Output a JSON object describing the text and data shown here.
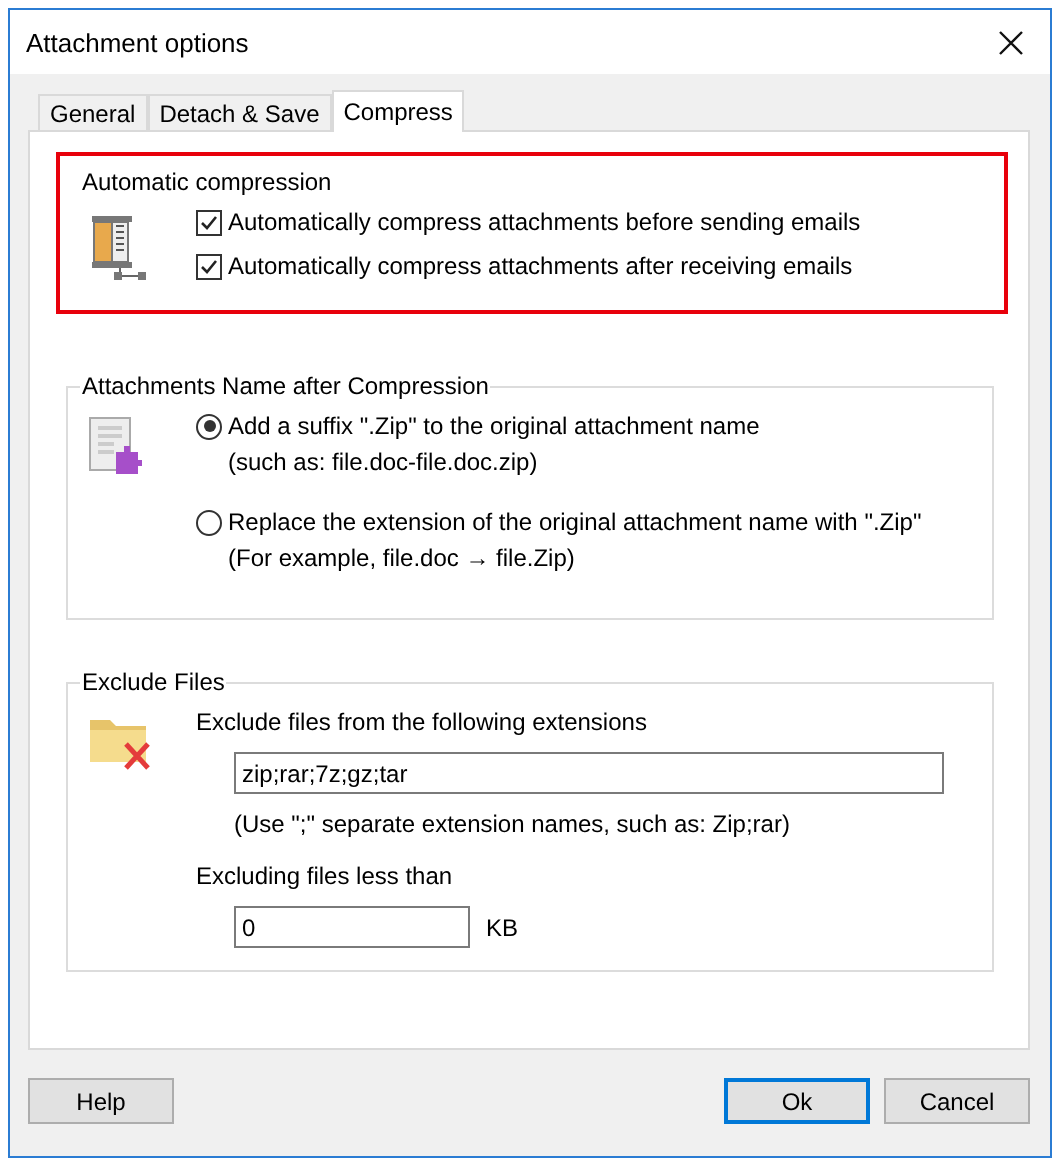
{
  "window": {
    "title": "Attachment options"
  },
  "tabs": [
    {
      "label": "General",
      "selected": false
    },
    {
      "label": "Detach & Save",
      "selected": false
    },
    {
      "label": "Compress",
      "selected": true
    }
  ],
  "groups": [
    {
      "kind": "checks",
      "title": "Automatic compression",
      "highlighted": true,
      "options": [
        {
          "label": "Automatically compress attachments before sending emails",
          "checked": true
        },
        {
          "label": "Automatically compress attachments after receiving emails",
          "checked": true
        }
      ]
    },
    {
      "kind": "radios",
      "title": "Attachments Name after Compression",
      "highlighted": false,
      "options": [
        {
          "label": "Add a suffix \".Zip\" to the original attachment name",
          "note": "(such as: file.doc-file.doc.zip)",
          "selected": true
        },
        {
          "label": "Replace the extension of the original attachment name with \".Zip\"",
          "note": "(For example, file.doc → file.Zip)",
          "selected": false
        }
      ]
    },
    {
      "kind": "exclude",
      "title": "Exclude Files",
      "highlighted": false,
      "extensions": {
        "label": "Exclude files from the following extensions",
        "value": "zip;rar;7z;gz;tar",
        "hint": "(Use \";\" separate extension names, such as: Zip;rar)"
      },
      "size": {
        "label": "Excluding files less than",
        "value": "0",
        "unit": "KB"
      }
    }
  ],
  "footer": {
    "left": [
      {
        "label": "Help",
        "default": false
      }
    ],
    "right": [
      {
        "label": "Ok",
        "default": true
      },
      {
        "label": "Cancel",
        "default": false
      }
    ]
  }
}
